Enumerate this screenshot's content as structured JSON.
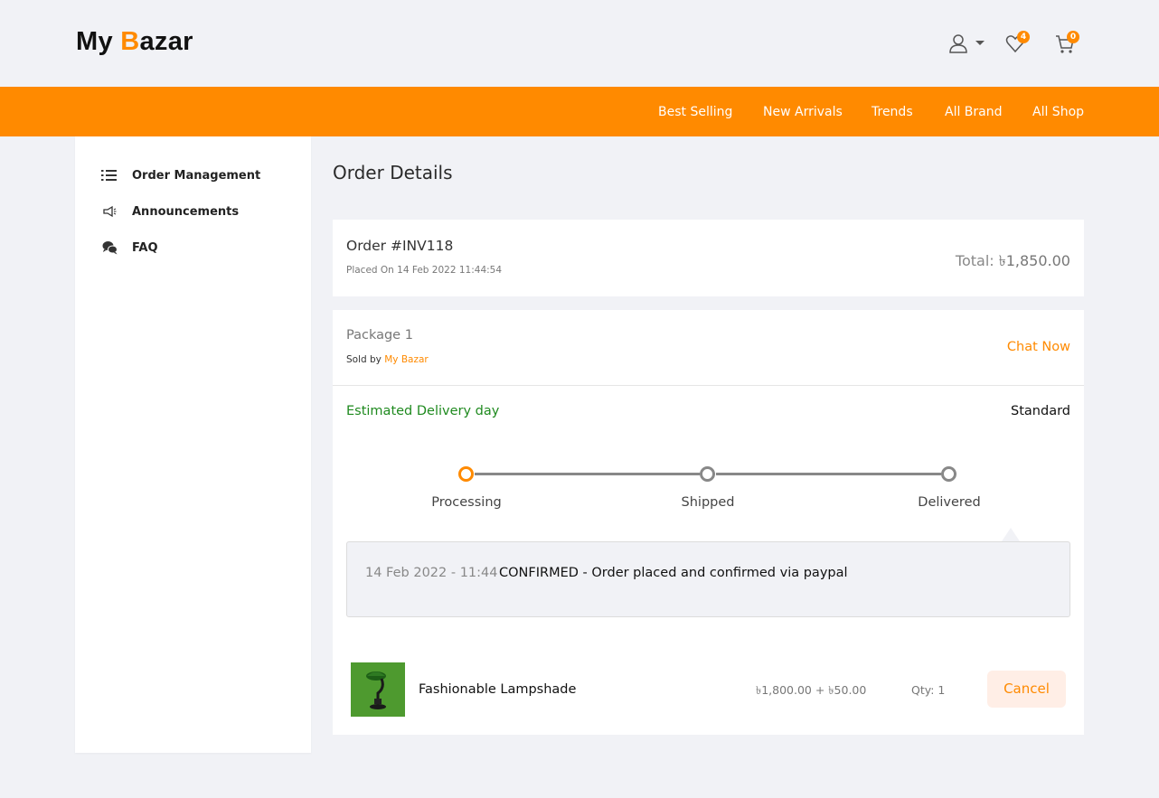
{
  "header": {
    "logo_prefix": "My ",
    "logo_b": "B",
    "logo_suffix": "azar",
    "wishlist_count": "4",
    "cart_count": "0",
    "icons": [
      "user-icon",
      "caret-down-icon",
      "heart-icon",
      "cart-icon"
    ]
  },
  "nav": {
    "items": [
      "Best Selling",
      "New Arrivals",
      "Trends",
      "All Brand",
      "All Shop"
    ]
  },
  "sidebar": {
    "items": [
      {
        "label": "Order Management",
        "icon": "list-icon"
      },
      {
        "label": "Announcements",
        "icon": "megaphone-icon"
      },
      {
        "label": "FAQ",
        "icon": "chat-bubbles-icon"
      }
    ]
  },
  "page": {
    "title": "Order Details"
  },
  "order": {
    "number": "Order #INV118",
    "placed": "Placed On 14 Feb 2022 11:44:54",
    "total_label": "Total: ",
    "total_amount": "৳1,850.00"
  },
  "package": {
    "title": "Package 1",
    "sold_by_label": "Sold by ",
    "seller": "My Bazar",
    "chat_label": "Chat Now",
    "estimated_label": "Estimated Delivery day",
    "shipping_type": "Standard",
    "steps": [
      "Processing",
      "Shipped",
      "Delivered"
    ],
    "current_step": "Processing",
    "log": {
      "date": "14 Feb 2022 - 11:44",
      "text": "CONFIRMED - Order placed and confirmed via paypal"
    },
    "item": {
      "name": "Fashionable Lampshade",
      "price": "৳1,800.00 + ৳50.00",
      "qty": "Qty: 1",
      "cancel_label": "Cancel"
    }
  },
  "colors": {
    "accent": "#ff8a00",
    "background": "#f1f2f6",
    "success": "#1f8a1f",
    "cancel_bg": "#ffeee6"
  }
}
